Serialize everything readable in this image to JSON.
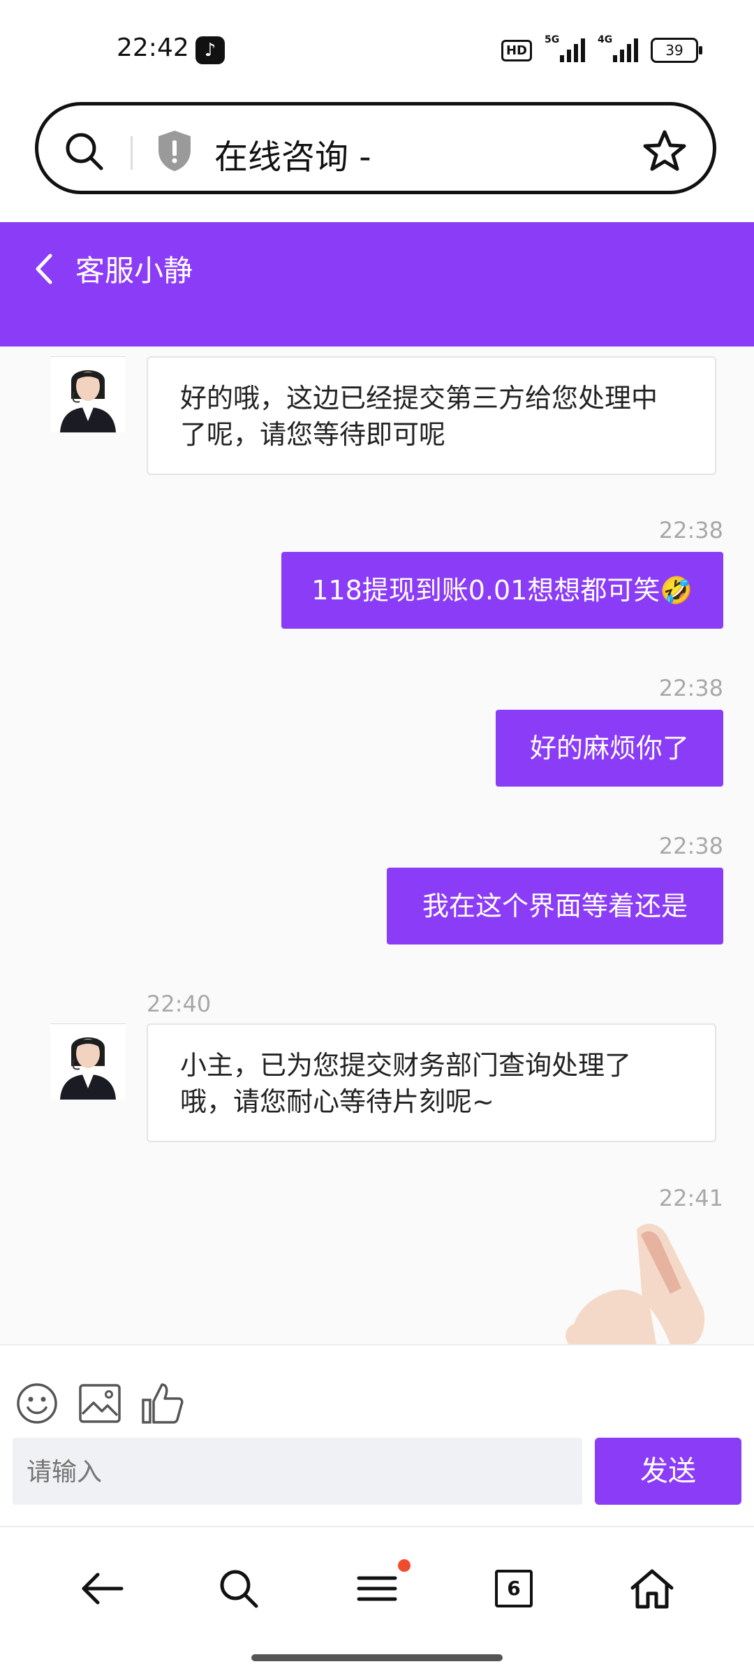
{
  "status_bar": {
    "time": "22:42",
    "network_labels": [
      "HD",
      "5G",
      "4G"
    ],
    "battery": "39"
  },
  "browser": {
    "page_title": "在线咨询 -"
  },
  "chat_header": {
    "agent_name": "客服小静"
  },
  "messages": [
    {
      "side": "in",
      "text": "好的哦，这边已经提交第三方给您处理中了呢，请您等待即可呢"
    },
    {
      "side": "out",
      "time": "22:38",
      "text": "118提现到账0.01想想都可笑🤣"
    },
    {
      "side": "out",
      "time": "22:38",
      "text": "好的麻烦你了"
    },
    {
      "side": "out",
      "time": "22:38",
      "text": "我在这个界面等着还是"
    },
    {
      "side": "in",
      "time": "22:40",
      "text": "小主，已为您提交财务部门查询处理了哦，请您耐心等待片刻呢~"
    },
    {
      "side": "out",
      "time": "22:41",
      "text": ""
    }
  ],
  "composer": {
    "tools": [
      "emoji-icon",
      "image-icon",
      "thumbs-up-icon"
    ],
    "placeholder": "请输入",
    "send_label": "发送"
  },
  "bottom_nav": {
    "items": [
      "back-icon",
      "search-icon",
      "menu-icon",
      "tabs-icon",
      "home-icon"
    ],
    "tab_count": "6"
  },
  "colors": {
    "accent": "#8b3cf7",
    "notification_dot": "#f04d2e"
  }
}
